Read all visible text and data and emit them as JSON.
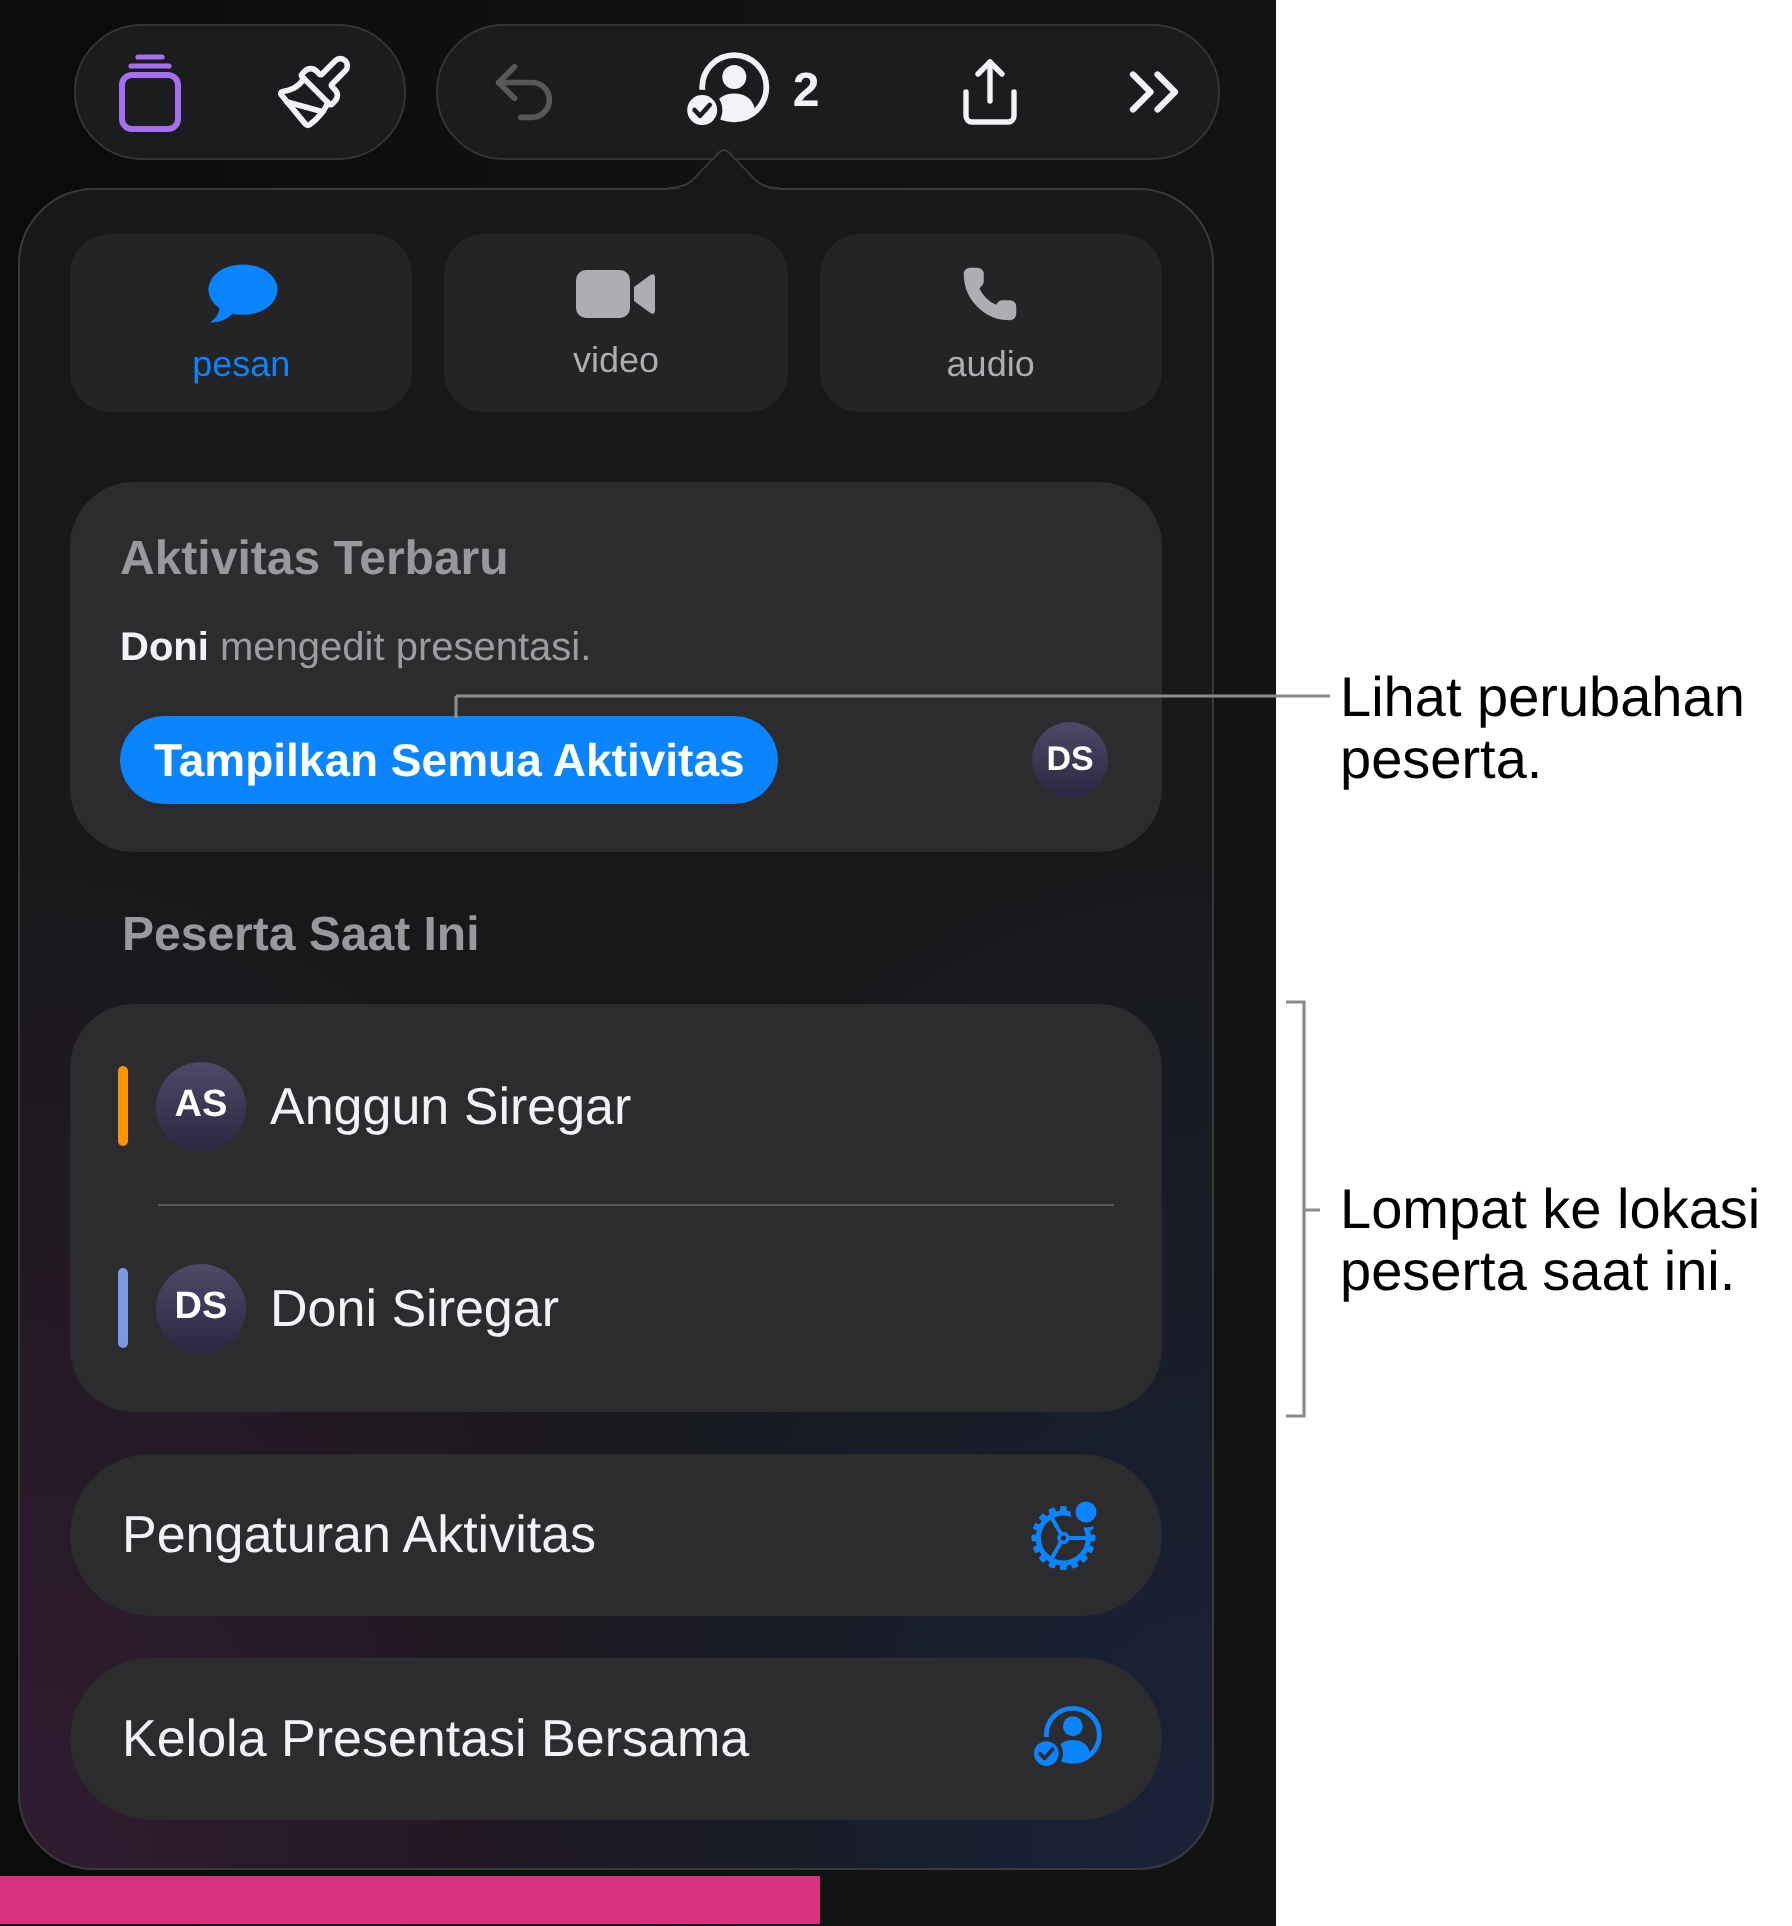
{
  "toolbar": {
    "left": [
      {
        "kind": "pages",
        "active": true
      },
      {
        "kind": "brush",
        "active": false
      }
    ],
    "right": [
      {
        "kind": "undo",
        "disabled": true
      },
      {
        "kind": "collaborate",
        "count": "2",
        "disabled": false
      },
      {
        "kind": "share",
        "disabled": false
      },
      {
        "kind": "more",
        "disabled": false
      }
    ]
  },
  "contact_options": [
    {
      "kind": "message",
      "label": "pesan",
      "selected": true
    },
    {
      "kind": "video",
      "label": "video",
      "selected": false
    },
    {
      "kind": "audio",
      "label": "audio",
      "selected": false
    }
  ],
  "recent_activity": {
    "title": "Aktivitas Terbaru",
    "message": "**Doni** mengedit presentasi.",
    "button": "Tampilkan Semua Aktivitas",
    "avatar": "DS"
  },
  "participants": {
    "title": "Peserta Saat Ini",
    "items": [
      {
        "initials": "AS",
        "name": "Anggun Siregar",
        "color": "#ff9500"
      },
      {
        "initials": "DS",
        "name": "Doni Siregar",
        "color": "#7a9ae6"
      }
    ]
  },
  "actions": [
    {
      "kind": "settings",
      "label": "Pengaturan Aktivitas"
    },
    {
      "kind": "manage",
      "label": "Kelola Presentasi Bersama"
    }
  ],
  "callouts": [
    {
      "text": "Lihat perubahan peserta."
    },
    {
      "text": "Lompat ke lokasi peserta saat ini."
    }
  ]
}
